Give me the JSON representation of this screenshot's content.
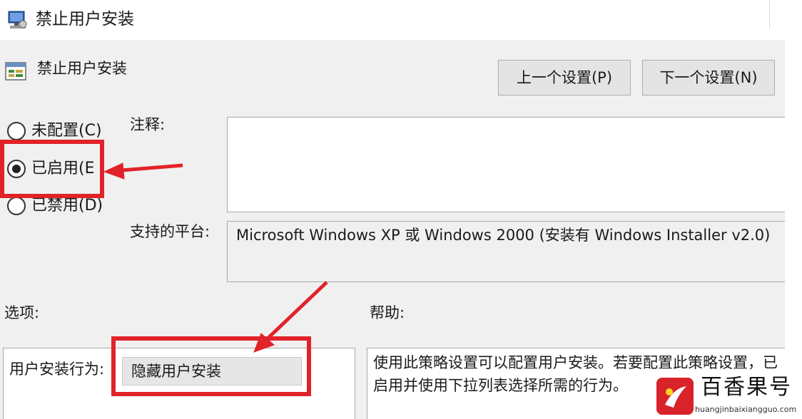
{
  "window": {
    "title": "禁止用户安装"
  },
  "header": {
    "policy_title": "禁止用户安装"
  },
  "nav": {
    "prev_label": "上一个设置(P)",
    "next_label": "下一个设置(N)"
  },
  "state": {
    "options": [
      {
        "label": "未配置(C)",
        "selected": false
      },
      {
        "label": "已启用(E",
        "selected": true
      },
      {
        "label": "已禁用(D)",
        "selected": false
      }
    ]
  },
  "comment": {
    "label": "注释:",
    "value": ""
  },
  "platform": {
    "label": "支持的平台:",
    "value": "Microsoft Windows XP 或 Windows 2000 (安装有 Windows Installer v2.0)"
  },
  "options_section": {
    "label": "选项:",
    "behavior_label": "用户安装行为:",
    "behavior_value": "隐藏用户安装"
  },
  "help_section": {
    "label": "帮助:",
    "text": "使用此策略设置可以配置用户安装。若要配置此策略设置，已启用并使用下拉列表选择所需的行为。"
  },
  "watermark": {
    "title": "百香果号",
    "url": "huangjinbaixiangguo.com"
  },
  "colors": {
    "highlight": "#e12229",
    "dialog_bg": "#f0f0f0"
  },
  "icons": {
    "title": "gpedit-icon",
    "policy": "policy-setting-icon"
  }
}
